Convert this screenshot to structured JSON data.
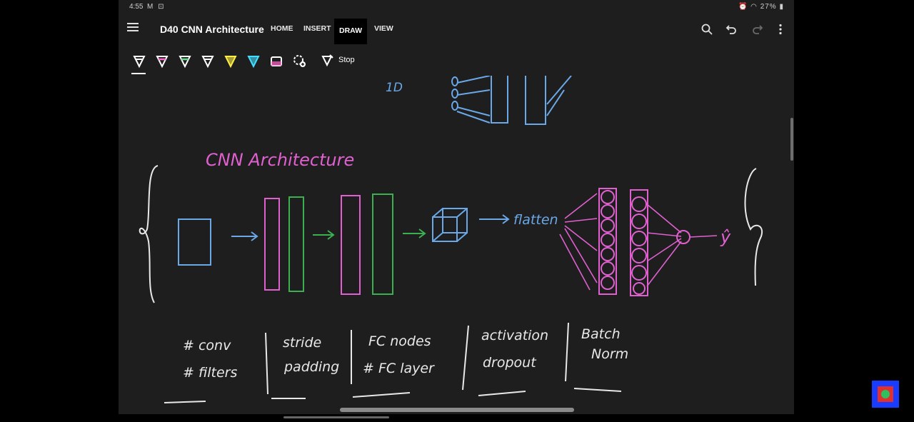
{
  "status": {
    "time": "4:55",
    "left_icons": "M ⊡",
    "battery": "27%"
  },
  "appbar": {
    "title": "D40 CNN Architecture",
    "tabs": [
      "HOME",
      "INSERT",
      "DRAW",
      "VIEW"
    ],
    "active_tab": "DRAW",
    "icons": [
      "search-icon",
      "undo-icon",
      "redo-icon",
      "more-icon"
    ]
  },
  "toolbar": {
    "pens": [
      {
        "name": "pen-white",
        "color": "#ffffff"
      },
      {
        "name": "pen-pink",
        "color": "#ff66cc"
      },
      {
        "name": "pen-green",
        "color": "#66dd88"
      },
      {
        "name": "pen-white-2",
        "color": "#ffffff"
      },
      {
        "name": "highlighter-yellow",
        "color": "#ffee44"
      },
      {
        "name": "highlighter-cyan",
        "color": "#44ddff"
      }
    ],
    "stop_label": "Stop"
  },
  "canvas": {
    "top_fragment": "1D",
    "heading": "CNN Architecture",
    "flatten_label": "flatten",
    "output_label": "ŷ",
    "notes": [
      {
        "lines": [
          "# conv",
          "# filters"
        ]
      },
      {
        "lines": [
          "stride",
          "padding"
        ]
      },
      {
        "lines": [
          "FC nodes",
          "# FC layer"
        ]
      },
      {
        "lines": [
          "activation",
          "dropout"
        ]
      },
      {
        "lines": [
          "Batch",
          "Norm"
        ]
      }
    ]
  },
  "colors": {
    "pink": "#e060d0",
    "green": "#3cb050",
    "blue": "#6aa8e8",
    "white": "#e8e8e8"
  }
}
